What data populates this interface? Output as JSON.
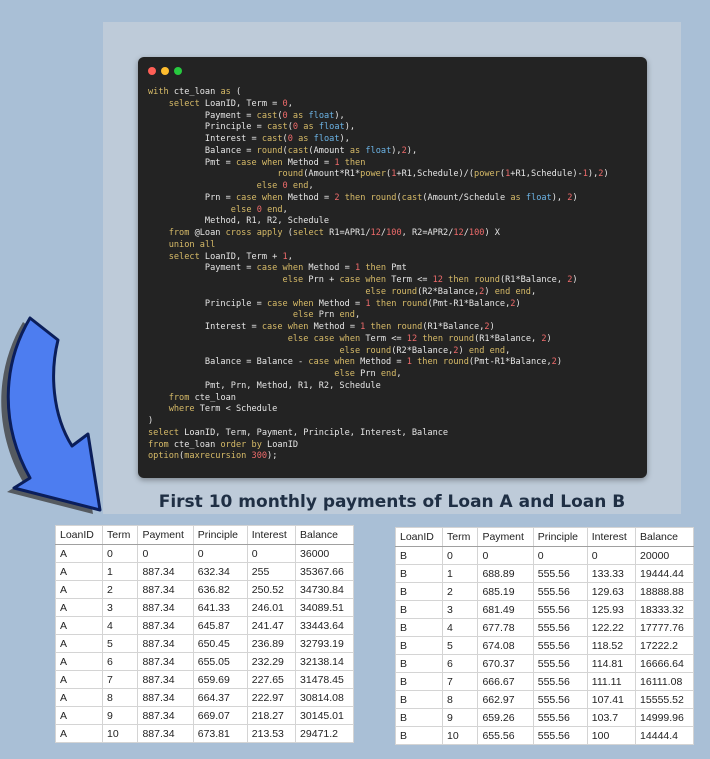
{
  "code": {
    "lines": [
      "with cte_loan as (",
      "    select LoanID, Term = 0,",
      "           Payment = cast(0 as float),",
      "           Principle = cast(0 as float),",
      "           Interest = cast(0 as float),",
      "           Balance = round(cast(Amount as float),2),",
      "           Pmt = case when Method = 1 then",
      "                         round(Amount*R1*power(1+R1,Schedule)/(power(1+R1,Schedule)-1),2)",
      "                     else 0 end,",
      "           Prn = case when Method = 2 then round(cast(Amount/Schedule as float), 2)",
      "                else 0 end,",
      "           Method, R1, R2, Schedule",
      "    from @Loan cross apply (select R1=APR1/12/100, R2=APR2/12/100) X",
      "    union all",
      "    select LoanID, Term + 1,",
      "           Payment = case when Method = 1 then Pmt",
      "                          else Prn + case when Term <= 12 then round(R1*Balance, 2)",
      "                                          else round(R2*Balance,2) end end,",
      "           Principle = case when Method = 1 then round(Pmt-R1*Balance,2)",
      "                            else Prn end,",
      "           Interest = case when Method = 1 then round(R1*Balance,2)",
      "                           else case when Term <= 12 then round(R1*Balance, 2)",
      "                                     else round(R2*Balance,2) end end,",
      "           Balance = Balance - case when Method = 1 then round(Pmt-R1*Balance,2)",
      "                                    else Prn end,",
      "           Pmt, Prn, Method, R1, R2, Schedule",
      "    from cte_loan",
      "    where Term < Schedule",
      ")",
      "select LoanID, Term, Payment, Principle, Interest, Balance",
      "from cte_loan order by LoanID",
      "option(maxrecursion 300);"
    ]
  },
  "caption": "First 10 monthly payments of Loan A and Loan B",
  "table_a": {
    "headers": [
      "LoanID",
      "Term",
      "Payment",
      "Principle",
      "Interest",
      "Balance"
    ],
    "rows": [
      [
        "A",
        "0",
        "0",
        "0",
        "0",
        "36000"
      ],
      [
        "A",
        "1",
        "887.34",
        "632.34",
        "255",
        "35367.66"
      ],
      [
        "A",
        "2",
        "887.34",
        "636.82",
        "250.52",
        "34730.84"
      ],
      [
        "A",
        "3",
        "887.34",
        "641.33",
        "246.01",
        "34089.51"
      ],
      [
        "A",
        "4",
        "887.34",
        "645.87",
        "241.47",
        "33443.64"
      ],
      [
        "A",
        "5",
        "887.34",
        "650.45",
        "236.89",
        "32793.19"
      ],
      [
        "A",
        "6",
        "887.34",
        "655.05",
        "232.29",
        "32138.14"
      ],
      [
        "A",
        "7",
        "887.34",
        "659.69",
        "227.65",
        "31478.45"
      ],
      [
        "A",
        "8",
        "887.34",
        "664.37",
        "222.97",
        "30814.08"
      ],
      [
        "A",
        "9",
        "887.34",
        "669.07",
        "218.27",
        "30145.01"
      ],
      [
        "A",
        "10",
        "887.34",
        "673.81",
        "213.53",
        "29471.2"
      ]
    ]
  },
  "table_b": {
    "headers": [
      "LoanID",
      "Term",
      "Payment",
      "Principle",
      "Interest",
      "Balance"
    ],
    "rows": [
      [
        "B",
        "0",
        "0",
        "0",
        "0",
        "20000"
      ],
      [
        "B",
        "1",
        "688.89",
        "555.56",
        "133.33",
        "19444.44"
      ],
      [
        "B",
        "2",
        "685.19",
        "555.56",
        "129.63",
        "18888.88"
      ],
      [
        "B",
        "3",
        "681.49",
        "555.56",
        "125.93",
        "18333.32"
      ],
      [
        "B",
        "4",
        "677.78",
        "555.56",
        "122.22",
        "17777.76"
      ],
      [
        "B",
        "5",
        "674.08",
        "555.56",
        "118.52",
        "17222.2"
      ],
      [
        "B",
        "6",
        "670.37",
        "555.56",
        "114.81",
        "16666.64"
      ],
      [
        "B",
        "7",
        "666.67",
        "555.56",
        "111.11",
        "16111.08"
      ],
      [
        "B",
        "8",
        "662.97",
        "555.56",
        "107.41",
        "15555.52"
      ],
      [
        "B",
        "9",
        "659.26",
        "555.56",
        "103.7",
        "14999.96"
      ],
      [
        "B",
        "10",
        "655.56",
        "555.56",
        "100",
        "14444.4"
      ]
    ]
  },
  "icons": {
    "window_controls": [
      "close-dot",
      "minimize-dot",
      "maximize-dot"
    ],
    "arrow": "curved-arrow-icon"
  },
  "colors": {
    "background": "#a9bfd6",
    "panel": "#becbd9",
    "code_background": "#232323",
    "keyword": "#d7bb68",
    "number": "#ee6b6b",
    "type": "#6cb4e6",
    "arrow_fill": "#4d7df0",
    "caption": "#1f2f44"
  }
}
